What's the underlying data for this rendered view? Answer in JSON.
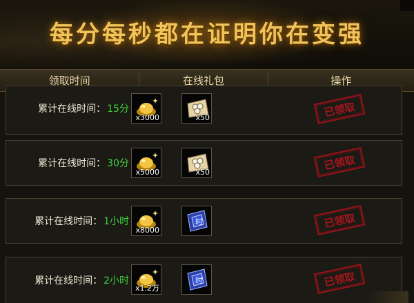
{
  "banner": {
    "title": "每分每秒都在证明你在变强"
  },
  "header": {
    "col_time": "领取时间",
    "col_gift": "在线礼包",
    "col_action": "操作"
  },
  "rows": [
    {
      "label": "累计在线时间：",
      "time": "15分",
      "item1": {
        "icon": "gold-ingot-icon",
        "qty": "x3000"
      },
      "item2": {
        "icon": "rice-ball-pack-icon",
        "qty": "x50"
      },
      "status": "已领取"
    },
    {
      "label": "累计在线时间：",
      "time": "30分",
      "item1": {
        "icon": "gold-ingot-icon",
        "qty": "x5000"
      },
      "item2": {
        "icon": "rice-ball-pack-icon",
        "qty": "x50"
      },
      "status": "已领取"
    },
    {
      "label": "累计在线时间：",
      "time": "1小时",
      "item1": {
        "icon": "gold-ingot-icon",
        "qty": "x8000"
      },
      "item2": {
        "icon": "blue-scroll-icon",
        "qty": ""
      },
      "status": "已领取"
    },
    {
      "label": "累计在线时间：",
      "time": "2小时",
      "item1": {
        "icon": "gold-ingot-icon",
        "qty": "x1.2万"
      },
      "item2": {
        "icon": "blue-scroll-icon",
        "qty": ""
      },
      "status": "已领取"
    }
  ],
  "colors": {
    "accent_gold": "#f0c45a",
    "time_green": "#3fd43f",
    "stamp_red": "#b5161f"
  }
}
